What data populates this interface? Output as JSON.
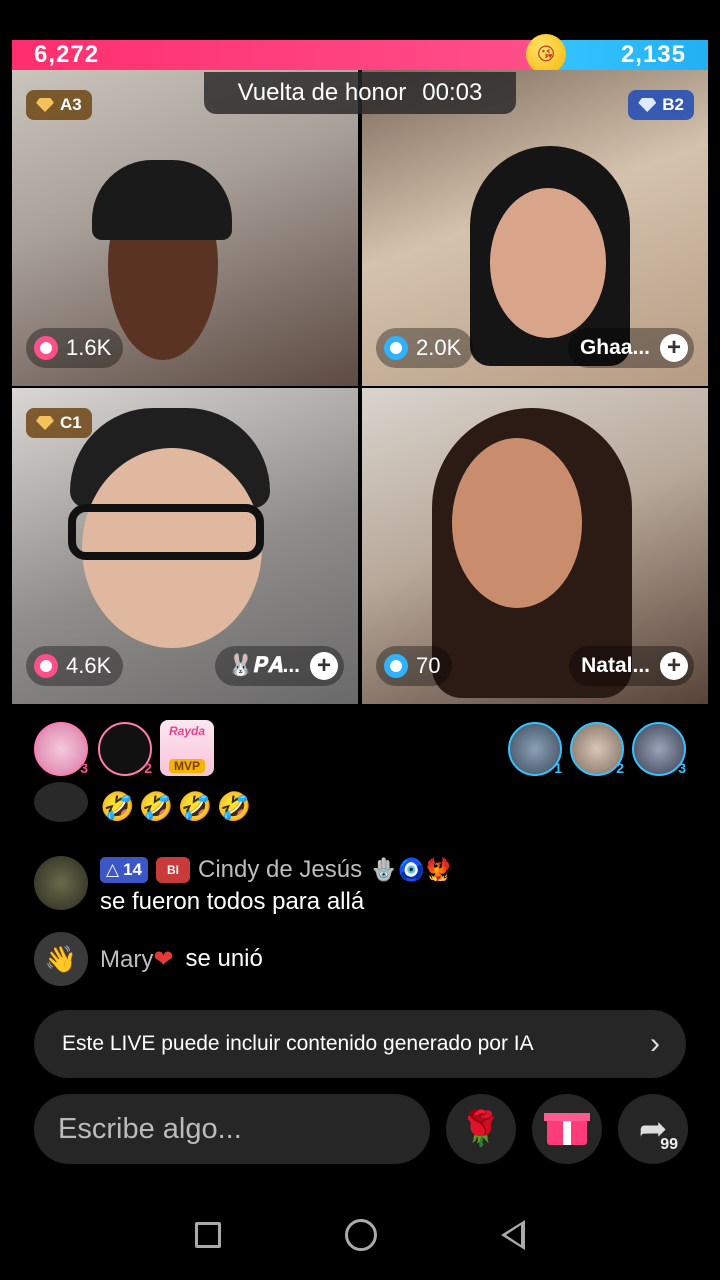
{
  "score": {
    "left": "6,272",
    "right": "2,135",
    "left_color": "#ff2e6e",
    "right_color": "#35c3ff",
    "emoji": "😘"
  },
  "timer": {
    "label": "Vuelta de honor",
    "value": "00:03"
  },
  "tiles": [
    {
      "badge": "A3",
      "viewers": "1.6K",
      "name": ""
    },
    {
      "badge": "B2",
      "viewers": "2.0K",
      "name": "Ghaa..."
    },
    {
      "badge": "C1",
      "viewers": "4.6K",
      "name": "🐰𝑷𝑨..."
    },
    {
      "badge": "",
      "viewers": "70",
      "name": "Natal..."
    }
  ],
  "ranks": {
    "left": [
      {
        "n": "3"
      },
      {
        "n": "2"
      }
    ],
    "mvp": {
      "name": "Rayda",
      "tag": "MVP"
    },
    "right": [
      {
        "n": "1"
      },
      {
        "n": "2"
      },
      {
        "n": "3"
      }
    ]
  },
  "chat": {
    "emoji_line": "🤣🤣🤣🤣",
    "cindy": {
      "level": "14",
      "heart_badge": "BI",
      "user": "Cindy de Jesús",
      "decor": "🪬🧿🐦‍🔥",
      "message": "se fueron todos para allá"
    },
    "join": {
      "user": "Mary",
      "heart": "❤",
      "action": "se unió"
    }
  },
  "ai_notice": "Este LIVE puede incluir contenido generado por IA",
  "input": {
    "placeholder": "Escribe algo..."
  },
  "share_count": "99"
}
